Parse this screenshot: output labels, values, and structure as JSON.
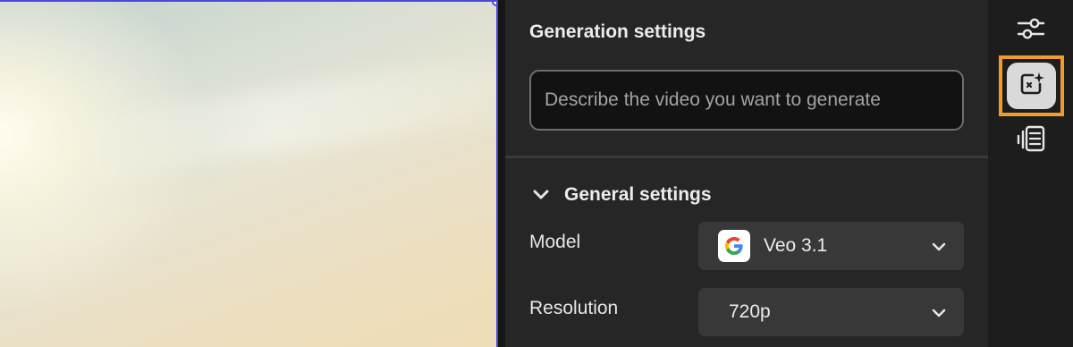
{
  "panel": {
    "title": "Generation settings",
    "prompt": {
      "value": "",
      "placeholder": "Describe the video you want to generate"
    },
    "general_settings": {
      "title": "General settings",
      "expanded": true,
      "model": {
        "label": "Model",
        "value": "Veo 3.1",
        "icon": "google-logo-icon"
      },
      "resolution": {
        "label": "Resolution",
        "value": "720p"
      }
    }
  },
  "rail": {
    "items": [
      {
        "icon": "sliders-icon",
        "active": false
      },
      {
        "icon": "generate-video-icon",
        "active": true
      },
      {
        "icon": "audio-transcript-icon",
        "active": false
      }
    ]
  },
  "colors": {
    "panel_bg": "#262626",
    "rail_bg": "#1d1d1d",
    "dropdown_bg": "#383838",
    "active_highlight": "#f19b2c",
    "selection_border": "#4a4ad8"
  }
}
